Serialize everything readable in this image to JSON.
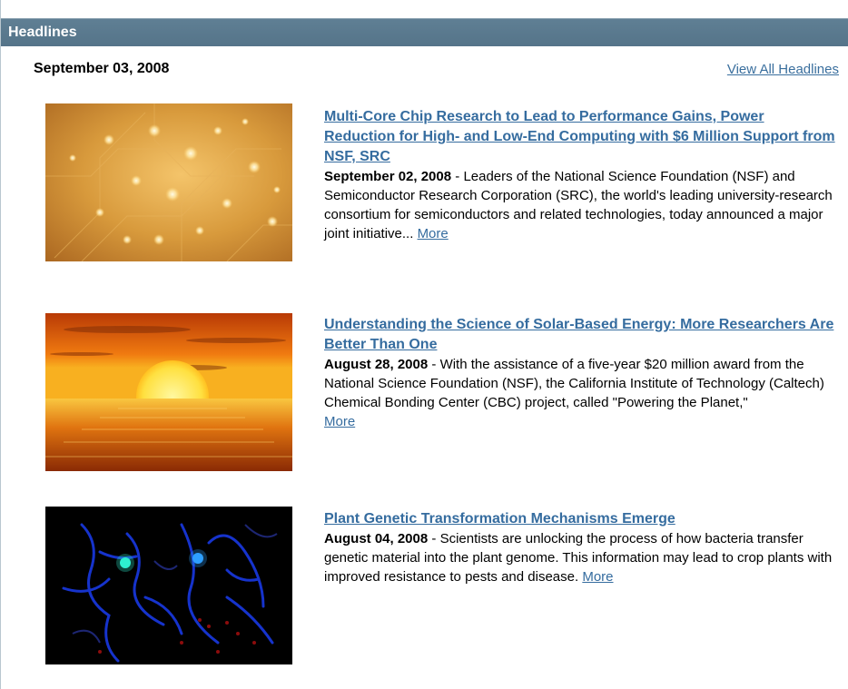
{
  "header": {
    "title": "Headlines"
  },
  "date": "September 03, 2008",
  "view_all_label": "View All Headlines",
  "items": [
    {
      "title": "Multi-Core Chip Research to Lead to Performance Gains, Power Reduction for High- and Low-End Computing with $6 Million Support from NSF, SRC",
      "date": "September 02, 2008",
      "sep": " - ",
      "summary": "Leaders of the National Science Foundation (NSF) and Semiconductor Research Corporation (SRC), the world's leading university-research consortium for semiconductors and related technologies, today announced a major joint initiative...",
      "more": "More"
    },
    {
      "title": "Understanding the Science of Solar-Based Energy: More Researchers Are Better Than One",
      "date": "August 28, 2008",
      "sep": " - ",
      "summary": "With the assistance of a five-year $20 million award from the National Science Foundation (NSF), the California Institute of Technology (Caltech) Chemical Bonding Center (CBC) project, called \"Powering the Planet,\"",
      "more": "More"
    },
    {
      "title": "Plant Genetic Transformation Mechanisms Emerge",
      "date": "August 04, 2008",
      "sep": " - ",
      "summary": "Scientists are unlocking the process of how bacteria transfer genetic material into the plant genome. This information may lead to crop plants with improved resistance to pests and disease.",
      "more": "More"
    }
  ],
  "colors": {
    "header_bg": "#587689",
    "link": "#356c9f"
  },
  "images": [
    "chip-lights-image",
    "sunset-ocean-image",
    "plant-cells-image"
  ]
}
